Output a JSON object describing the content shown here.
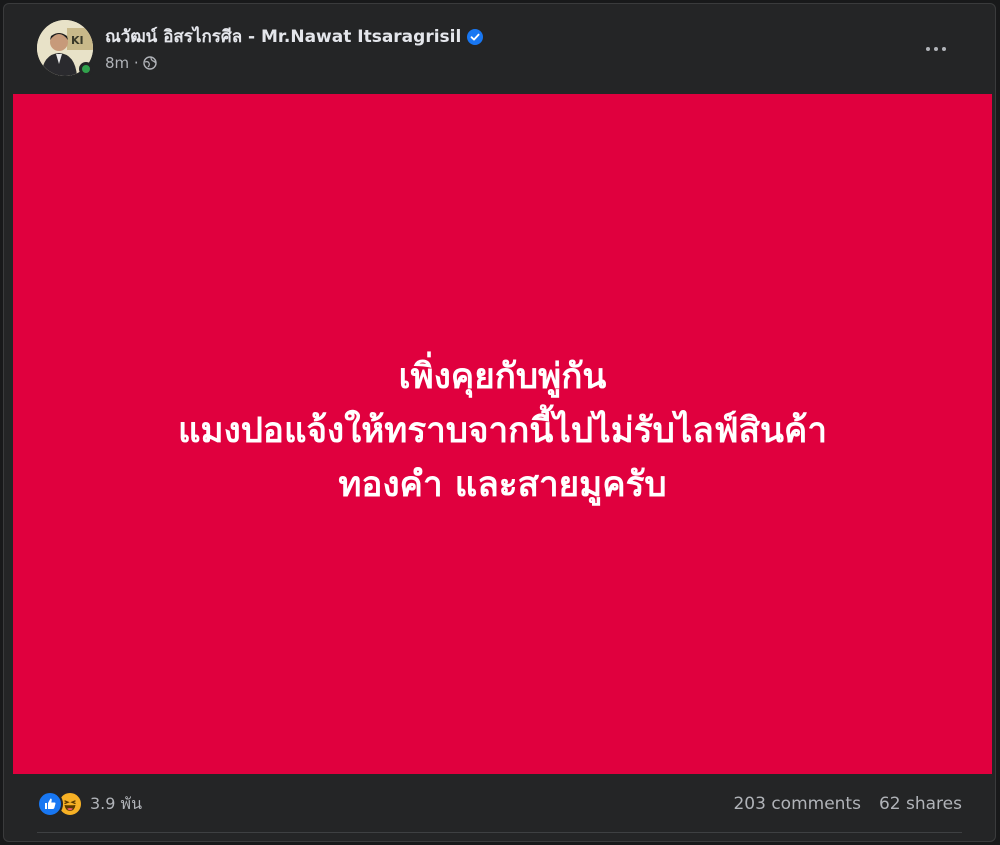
{
  "post": {
    "author": "ณวัฒน์ อิสรไกรศีล - Mr.Nawat Itsaragrisil",
    "time": "8m ·",
    "image_text": {
      "line1": "เพิ่งคุยกับพู่กัน",
      "line2": "แมงปอแจ้งให้ทราบจากนี้ไปไม่รับไลฟ์สินค้า",
      "line3": "ทองคำ และสายมูครับ"
    },
    "reactions_count": "3.9 พัน",
    "comments": "203 comments",
    "shares": "62 shares"
  },
  "icons": {
    "verified": "verified-badge-icon",
    "audience": "globe-icon",
    "more": "more-options-icon",
    "like": "like-reaction-icon",
    "haha": "haha-reaction-icon"
  },
  "colors": {
    "card_bg": "#242526",
    "image_bg": "#e0003e",
    "accent": "#1877f2",
    "online": "#31a24c"
  }
}
